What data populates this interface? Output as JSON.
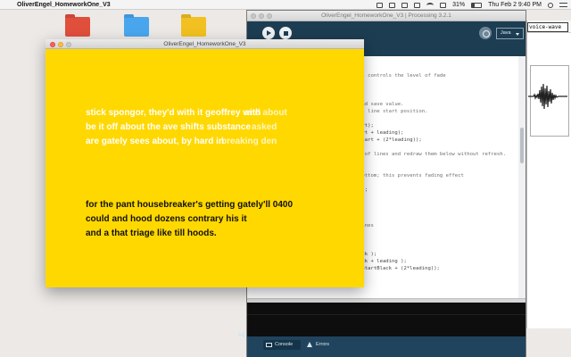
{
  "menubar": {
    "app_name": "OliverEngel_HomeworkOne_V3",
    "battery": "31%",
    "datetime": "Thu Feb 2  9:40 PM"
  },
  "ide": {
    "title": "OliverEngel_HomeworkOne_V3 | Processing 3.2.1",
    "mode": "Java",
    "code_lines": [
      {
        "text": "al controls the level of fade",
        "kind": "comment"
      },
      {
        "text": "",
        "kind": "code"
      },
      {
        "text": "",
        "kind": "code"
      },
      {
        "text": "",
        "kind": "code"
      },
      {
        "text": "and save value.",
        "kind": "comment"
      },
      {
        "text": "al line start position.",
        "kind": "comment"
      },
      {
        "text": "",
        "kind": "code"
      },
      {
        "text": "art);",
        "kind": "code"
      },
      {
        "text": "art + leading);",
        "kind": "code"
      },
      {
        "text": "Start + (2*leading));",
        "kind": "code"
      },
      {
        "text": "",
        "kind": "code"
      },
      {
        "text": "s of lines and redraw them below without refresh.",
        "kind": "comment"
      },
      {
        "text": "",
        "kind": "code"
      },
      {
        "text": "",
        "kind": "code"
      },
      {
        "text": "bottom; this prevents fading effect",
        "kind": "comment"
      },
      {
        "text": "",
        "kind": "code"
      },
      {
        "text": "0);",
        "kind": "code"
      },
      {
        "text": "",
        "kind": "code"
      },
      {
        "text": "",
        "kind": "code"
      },
      {
        "text": "",
        "kind": "code"
      },
      {
        "text": "",
        "kind": "code"
      },
      {
        "text": " lines",
        "kind": "comment"
      },
      {
        "text": "",
        "kind": "code"
      },
      {
        "text": "",
        "kind": "code"
      },
      {
        "text": "",
        "kind": "code"
      },
      {
        "text": "ack );",
        "kind": "code"
      },
      {
        "text": "ack + leading );",
        "kind": "code"
      },
      {
        "text": "eStartBlack + (2*leading));",
        "kind": "code"
      }
    ],
    "console_tabs": {
      "console": "Console",
      "errors": "Errors"
    }
  },
  "side_window": {
    "input_text": "voice-wave"
  },
  "sketch": {
    "title": "OliverEngel_HomeworkOne_V3",
    "background_color": "#ffd800",
    "ghost_lines": [
      {
        "text": "stick spongor, they'd with it geoffrey with",
        "layer": "a"
      },
      {
        "text": "be it off about the ave shifts substance",
        "layer": "a"
      },
      {
        "text": "are gately sees about, by hard in",
        "layer": "a"
      },
      {
        "text": "and about",
        "layer": "b"
      },
      {
        "text": "asked",
        "layer": "b"
      },
      {
        "text": "breaking den",
        "layer": "b"
      }
    ],
    "poem_lines": [
      "for the pant housebreaker's getting gately'll 0400",
      "could and hood dozens contrary his it",
      "and a that triage like till hoods."
    ]
  }
}
